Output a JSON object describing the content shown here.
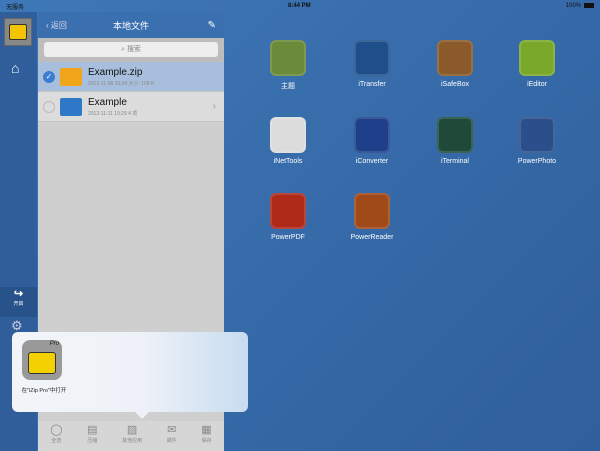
{
  "status": {
    "carrier": "无服务",
    "time": "8:44 PM",
    "battery": "100%"
  },
  "sidebar": {
    "share_label": "开启"
  },
  "panel": {
    "back": "返回",
    "title": "本地文件",
    "search_placeholder": "搜索",
    "files": [
      {
        "name": "Example.zip",
        "meta": "2013-11-08 15:34  大小: 108 K",
        "selected": true
      },
      {
        "name": "Example",
        "meta": "2013-11-11 19:29  4 项",
        "selected": false
      }
    ]
  },
  "toolbar": [
    "全选",
    "压缩",
    "其他应用",
    "邮件",
    "保存"
  ],
  "popover": {
    "app_label": "在\"iZip Pro\"中打开",
    "badge": "Pro"
  },
  "apps": [
    {
      "name": "主题",
      "color": "#6b8a3a"
    },
    {
      "name": "iTransfer",
      "color": "#1f4f8a"
    },
    {
      "name": "iSafeBox",
      "color": "#8a5a2a"
    },
    {
      "name": "iEditor",
      "color": "#7aa82a"
    },
    {
      "name": "iNetTools",
      "color": "#dcdcdc"
    },
    {
      "name": "iConverter",
      "color": "#1e3f8a"
    },
    {
      "name": "iTerminal",
      "color": "#1f4a3a"
    },
    {
      "name": "PowerPhoto",
      "color": "#2a4f8a"
    },
    {
      "name": "PowerPDF",
      "color": "#b02a1a"
    },
    {
      "name": "PowerReader",
      "color": "#a04a1a"
    }
  ]
}
